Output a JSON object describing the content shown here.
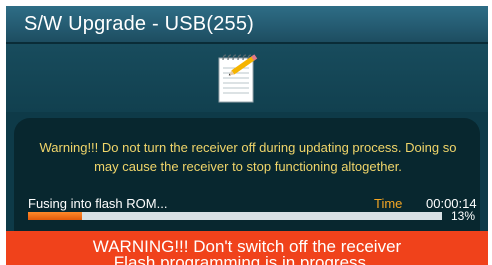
{
  "header": {
    "title": "S/W Upgrade - USB(255)"
  },
  "icons": {
    "upgrade": "notepad-pencil-icon"
  },
  "dialog": {
    "warning_message": "Warning!!! Do not turn the receiver off during updating process. Doing so may cause the receiver to stop functioning altogether.",
    "status_text": "Fusing into flash ROM...",
    "time_label": "Time",
    "time_value": "00:00:14",
    "progress_percent": "13%",
    "progress_fraction": 0.13
  },
  "banner": {
    "line1": "WARNING!!! Don't switch off the receiver",
    "line2": "Flash programming is in progress..."
  },
  "colors": {
    "background": "#0e3a48",
    "warning_text": "#f0d56a",
    "time_label": "#f5a623",
    "progress_fill": "#e45a0a",
    "banner": "#f0421b"
  }
}
